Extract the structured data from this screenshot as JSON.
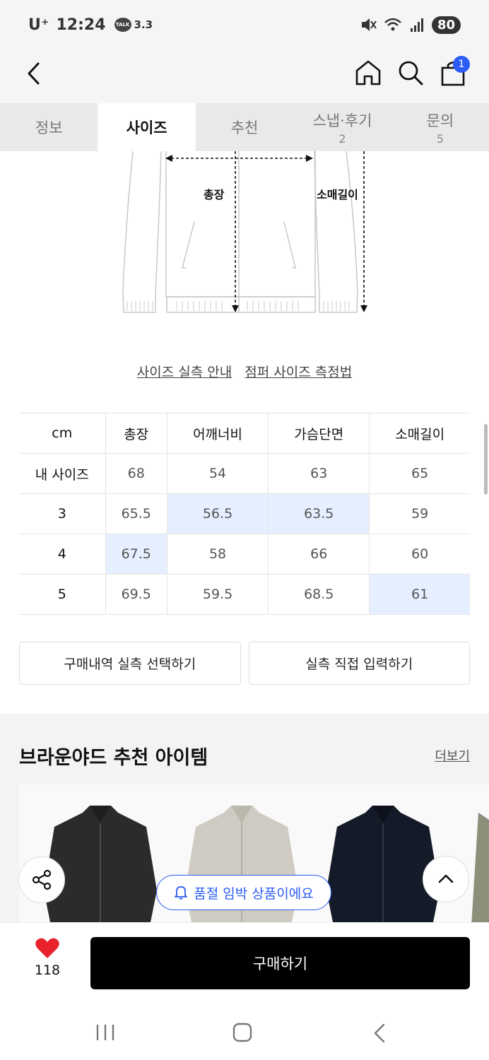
{
  "status_bar": {
    "carrier": "U⁺",
    "time": "12:24",
    "talk_icon": "talk-icon",
    "talk_text": "3.3",
    "battery": "80"
  },
  "nav": {
    "cart_count": "1"
  },
  "tabs": [
    {
      "label": "정보",
      "count": ""
    },
    {
      "label": "사이즈",
      "count": ""
    },
    {
      "label": "추천",
      "count": ""
    },
    {
      "label": "스냅·후기",
      "count": "2"
    },
    {
      "label": "문의",
      "count": "5"
    }
  ],
  "diagram": {
    "length_label": "총장",
    "sleeve_label": "소매길이"
  },
  "links": {
    "guide": "사이즈 실측 안내",
    "method": "점퍼 사이즈 측정법"
  },
  "table": {
    "headers": [
      "cm",
      "총장",
      "어깨너비",
      "가슴단면",
      "소매길이"
    ],
    "rows": [
      {
        "cells": [
          "내 사이즈",
          "68",
          "54",
          "63",
          "65"
        ],
        "highlight": [
          false,
          false,
          false,
          false,
          false
        ]
      },
      {
        "cells": [
          "3",
          "65.5",
          "56.5",
          "63.5",
          "59"
        ],
        "highlight": [
          false,
          false,
          true,
          true,
          false
        ]
      },
      {
        "cells": [
          "4",
          "67.5",
          "58",
          "66",
          "60"
        ],
        "highlight": [
          false,
          true,
          false,
          false,
          false
        ]
      },
      {
        "cells": [
          "5",
          "69.5",
          "59.5",
          "68.5",
          "61"
        ],
        "highlight": [
          false,
          false,
          false,
          false,
          true
        ]
      }
    ],
    "highlight_color": "#e6efff"
  },
  "buttons": {
    "purchase_history": "구매내역 실측 선택하기",
    "direct_input": "실측 직접 입력하기"
  },
  "recommend": {
    "title": "브라운야드 추천 아이템",
    "more": "더보기"
  },
  "floating": {
    "soldout": "품절 임박 상품이에요"
  },
  "bottom": {
    "like_count": "118",
    "buy": "구매하기",
    "like_color": "#e8232e"
  }
}
